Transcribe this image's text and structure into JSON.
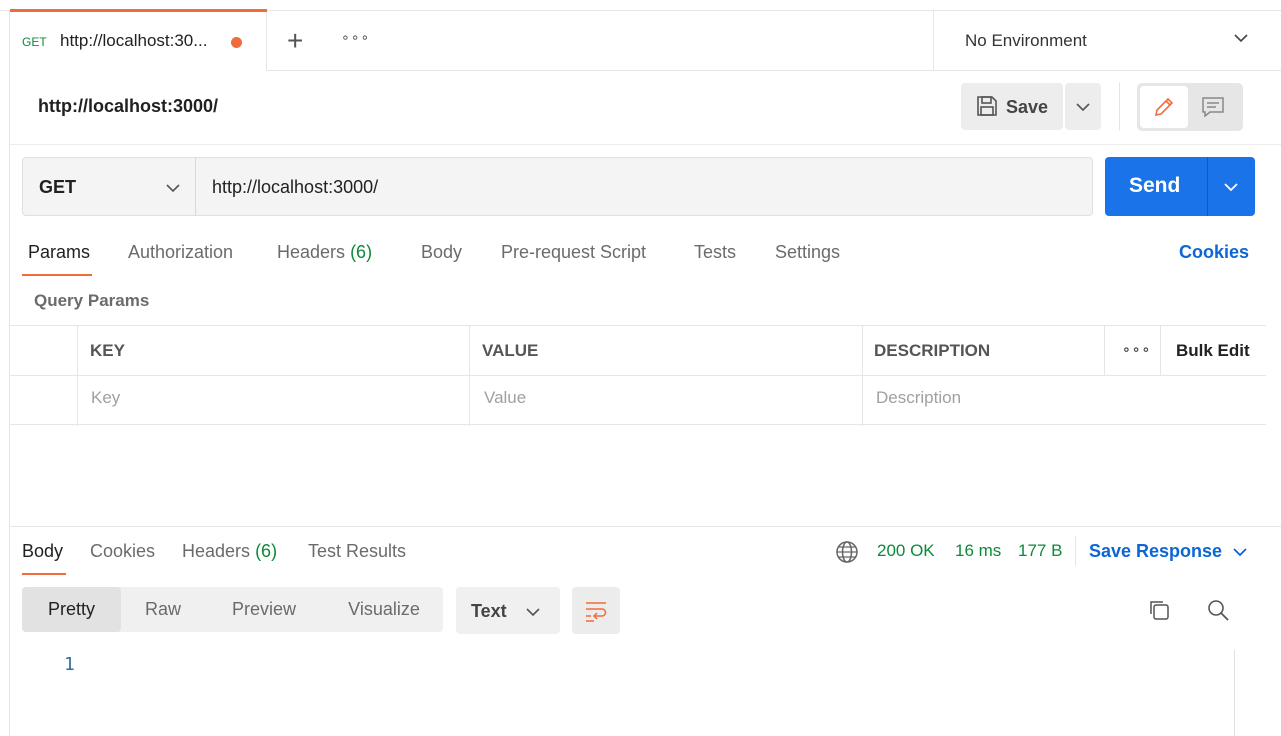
{
  "tab": {
    "method": "GET",
    "url": "http://localhost:30..."
  },
  "tabbar": {
    "new_tab": "+",
    "more": "∘∘∘"
  },
  "environment": {
    "label": "No Environment"
  },
  "request": {
    "title": "http://localhost:3000/",
    "save_label": "Save",
    "method": "GET",
    "url": "http://localhost:3000/",
    "send_label": "Send",
    "tabs": [
      {
        "label": "Params"
      },
      {
        "label": "Authorization"
      },
      {
        "label": "Headers",
        "count": "(6)"
      },
      {
        "label": "Body"
      },
      {
        "label": "Pre-request Script"
      },
      {
        "label": "Tests"
      },
      {
        "label": "Settings"
      }
    ],
    "cookies_label": "Cookies"
  },
  "params": {
    "title": "Query Params",
    "headers": [
      "KEY",
      "VALUE",
      "DESCRIPTION"
    ],
    "placeholders": [
      "Key",
      "Value",
      "Description"
    ],
    "more": "∘∘∘",
    "bulk_edit": "Bulk Edit"
  },
  "response": {
    "tabs": [
      {
        "label": "Body"
      },
      {
        "label": "Cookies"
      },
      {
        "label": "Headers",
        "count": "(6)"
      },
      {
        "label": "Test Results"
      }
    ],
    "status": "200 OK",
    "time": "16 ms",
    "size": "177 B",
    "save_response": "Save Response",
    "formats": [
      "Pretty",
      "Raw",
      "Preview",
      "Visualize"
    ],
    "type": "Text",
    "line_number": "1"
  },
  "colors": {
    "accent": "#f26b3a",
    "primary": "#1a73e8",
    "success": "#0c8a3a",
    "link": "#0b66d6"
  },
  "icons": [
    "save-icon",
    "chevron-down-icon",
    "pencil-icon",
    "comment-icon",
    "globe-icon",
    "wrap-lines-icon",
    "copy-icon",
    "search-icon"
  ]
}
